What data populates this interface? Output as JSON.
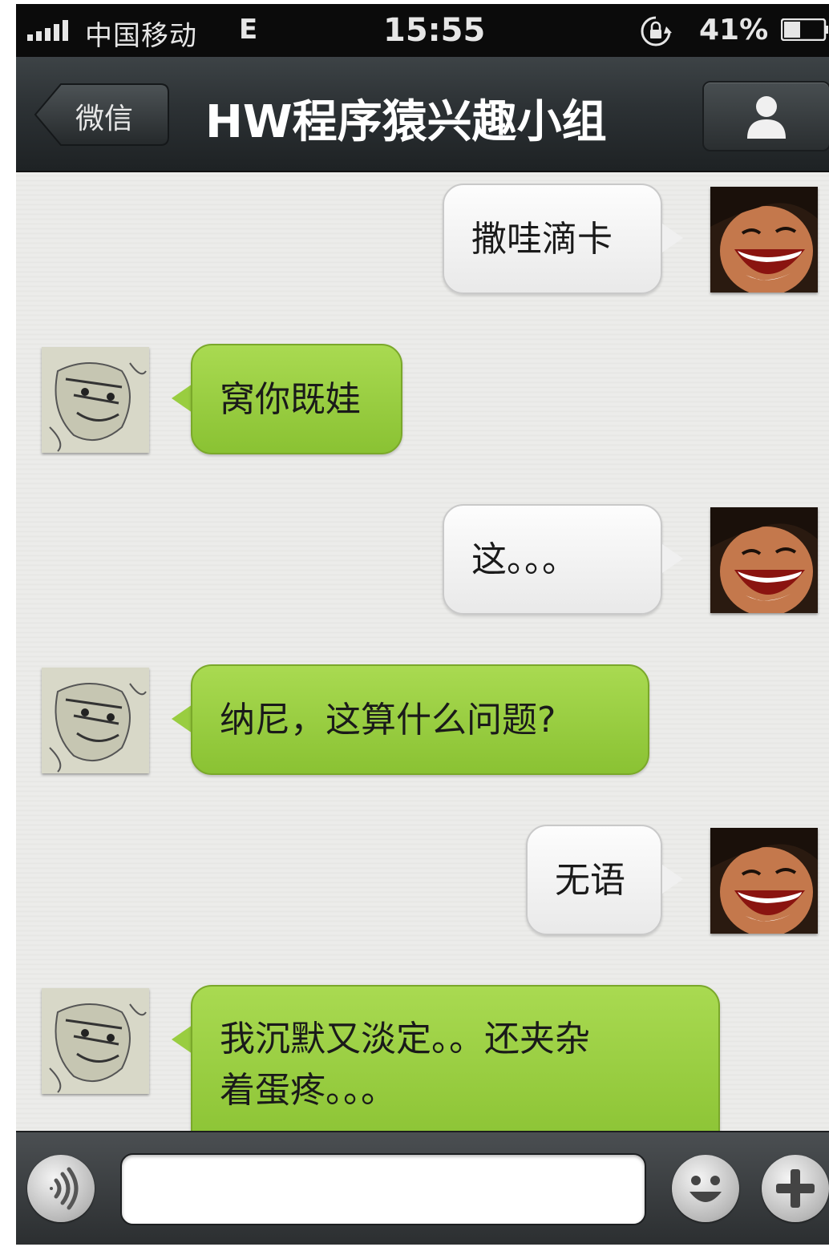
{
  "status_bar": {
    "carrier": "中国移动",
    "network": "E",
    "time": "15:55",
    "battery": "41%",
    "signal_icon": "signal-bars-icon",
    "lock_icon": "rotation-lock-icon",
    "battery_icon": "battery-icon"
  },
  "nav_bar": {
    "back_label": "微信",
    "title": "HW程序猿兴趣小组",
    "profile_icon": "person-icon"
  },
  "messages": [
    {
      "side": "right",
      "text": "撒哇滴卡",
      "sender": "self"
    },
    {
      "side": "left",
      "text": "窝你既娃",
      "sender": "other"
    },
    {
      "side": "right",
      "text": "这。。。",
      "sender": "self"
    },
    {
      "side": "left",
      "text": "纳尼，这算什么问题?",
      "sender": "other"
    },
    {
      "side": "right",
      "text": "无语",
      "sender": "self"
    },
    {
      "side": "left",
      "text": "我沉默又淡定。。还夹杂",
      "text_line2": "着蛋疼。。。",
      "sender": "other"
    }
  ],
  "input_bar": {
    "voice_icon": "voice-icon",
    "emoji_icon": "smiley-icon",
    "add_icon": "plus-icon",
    "input_value": ""
  },
  "colors": {
    "green_bubble": "#99cd40",
    "gray_bubble": "#f4f4f4",
    "nav_bg": "#2c3134",
    "status_bg": "#0b0b0b"
  }
}
